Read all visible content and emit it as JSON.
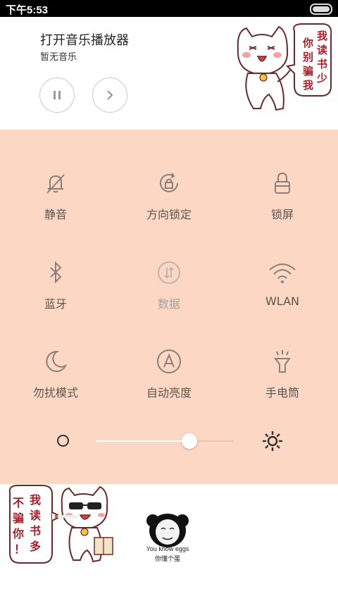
{
  "status_bar": {
    "time": "下午5:53",
    "battery_level": 1.0
  },
  "music": {
    "title": "打开音乐播放器",
    "subtitle": "暂无音乐",
    "pause_icon": "pause-icon",
    "next_icon": "chevron-right-icon",
    "sticker_text": "你别骗我 我读书少"
  },
  "quick_settings": {
    "row1": [
      {
        "label": "静音",
        "icon": "bell-off-icon"
      },
      {
        "label": "方向锁定",
        "icon": "rotation-lock-icon"
      },
      {
        "label": "锁屏",
        "icon": "lock-icon"
      }
    ],
    "row2": [
      {
        "label": "蓝牙",
        "icon": "bluetooth-icon"
      },
      {
        "label": "数据",
        "icon": "mobile-data-icon"
      },
      {
        "label": "WLAN",
        "icon": "wifi-icon"
      }
    ],
    "row3": [
      {
        "label": "勿扰模式",
        "icon": "moon-icon"
      },
      {
        "label": "自动亮度",
        "icon": "auto-brightness-icon"
      },
      {
        "label": "手电筒",
        "icon": "flashlight-icon"
      }
    ]
  },
  "brightness": {
    "level": 0.68,
    "low_icon": "brightness-low-icon",
    "high_icon": "brightness-high-icon"
  },
  "stickers": {
    "cat_text": "不骗你！ 我读书多",
    "panda_caption_en": "You know eggs",
    "panda_caption_cn": "你懂个蛋"
  },
  "colors": {
    "panel_bg": "#fcd7c4",
    "icon": "#8a7f7a",
    "label": "#5e5550",
    "dim_label": "#a9a29e"
  }
}
